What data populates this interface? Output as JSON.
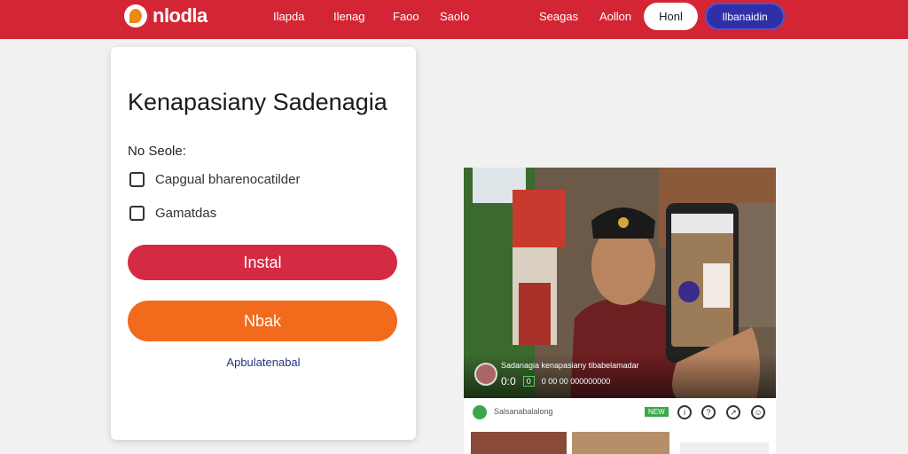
{
  "header": {
    "logo_text": "nlodla",
    "nav": [
      "Ilapda",
      "Ilenag",
      "Faoo",
      "Saolo"
    ],
    "nav_right": [
      "Seagas",
      "Aollon"
    ],
    "btn_white": "Honl",
    "btn_blue": "Ilbanaidin",
    "colors": {
      "bar": "#d42535",
      "blue": "#2f2fa8"
    }
  },
  "card": {
    "title": "Kenapasiany Sadenagia",
    "section_label": "No Seole:",
    "options": [
      {
        "label": "Capgual bharenocatilder",
        "checked": false
      },
      {
        "label": "Gamatdas",
        "checked": false
      }
    ],
    "install_label": "Instal",
    "secondary_label": "Nbak",
    "link_label": "Apbulatenabal",
    "colors": {
      "install": "#d42a43",
      "secondary": "#f26a1b"
    }
  },
  "media": {
    "caption_title": "Sadanagia kenapasiany tibabelamadar",
    "caption_meta": [
      "0:0",
      "0",
      "0 00 00 000000000"
    ],
    "strip_label": "Salsanabalalong",
    "strip_badge": "NEW"
  }
}
